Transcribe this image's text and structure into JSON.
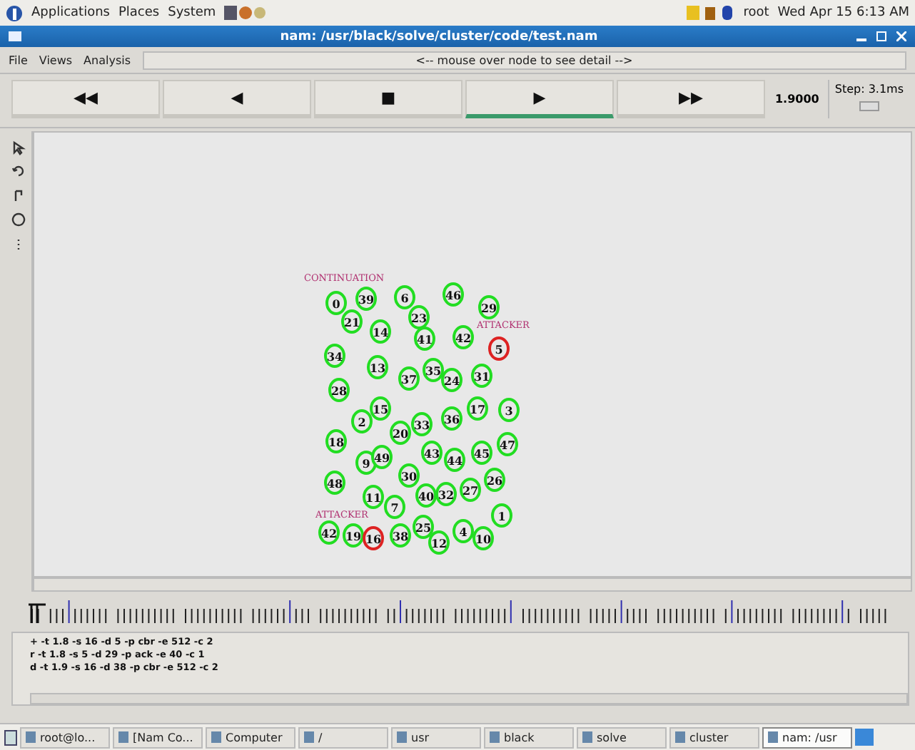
{
  "top_panel": {
    "menus": [
      "Applications",
      "Places",
      "System"
    ],
    "user": "root",
    "clock": "Wed Apr 15  6:13 AM"
  },
  "window": {
    "title": "nam: /usr/black/solve/cluster/code/test.nam"
  },
  "menubar": {
    "items": [
      "File",
      "Views",
      "Analysis"
    ],
    "status": "<-- mouse over node to see detail -->"
  },
  "controls": [
    {
      "label": "◀◀",
      "selected": false
    },
    {
      "label": "◀",
      "selected": false
    },
    {
      "label": "■",
      "selected": false
    },
    {
      "label": "▶",
      "selected": true
    },
    {
      "label": "▶▶",
      "selected": false
    }
  ],
  "time": "1.9000",
  "step": "Step: 3.1ms",
  "labels": [
    "CONTINUATION",
    "ATTACKER",
    "ATTACKER"
  ],
  "nodes": [
    {
      "label": "0",
      "color": "#22dd22"
    },
    {
      "label": "39",
      "color": "#22dd22"
    },
    {
      "label": "6",
      "color": "#22dd22"
    },
    {
      "label": "46",
      "color": "#22dd22"
    },
    {
      "label": "29",
      "color": "#22dd22"
    },
    {
      "label": "21",
      "color": "#22dd22"
    },
    {
      "label": "23",
      "color": "#22dd22"
    },
    {
      "label": "14",
      "color": "#22dd22"
    },
    {
      "label": "41",
      "color": "#22dd22"
    },
    {
      "label": "42",
      "color": "#22dd22"
    },
    {
      "label": "5",
      "color": "#dd2222"
    },
    {
      "label": "34",
      "color": "#22dd22"
    },
    {
      "label": "13",
      "color": "#22dd22"
    },
    {
      "label": "37",
      "color": "#22dd22"
    },
    {
      "label": "35",
      "color": "#22dd22"
    },
    {
      "label": "24",
      "color": "#22dd22"
    },
    {
      "label": "31",
      "color": "#22dd22"
    },
    {
      "label": "28",
      "color": "#22dd22"
    },
    {
      "label": "15",
      "color": "#22dd22"
    },
    {
      "label": "2",
      "color": "#22dd22"
    },
    {
      "label": "17",
      "color": "#22dd22"
    },
    {
      "label": "3",
      "color": "#22dd22"
    },
    {
      "label": "20",
      "color": "#22dd22"
    },
    {
      "label": "33",
      "color": "#22dd22"
    },
    {
      "label": "36",
      "color": "#22dd22"
    },
    {
      "label": "18",
      "color": "#22dd22"
    },
    {
      "label": "47",
      "color": "#22dd22"
    },
    {
      "label": "9",
      "color": "#22dd22"
    },
    {
      "label": "49",
      "color": "#22dd22"
    },
    {
      "label": "43",
      "color": "#22dd22"
    },
    {
      "label": "44",
      "color": "#22dd22"
    },
    {
      "label": "45",
      "color": "#22dd22"
    },
    {
      "label": "48",
      "color": "#22dd22"
    },
    {
      "label": "30",
      "color": "#22dd22"
    },
    {
      "label": "26",
      "color": "#22dd22"
    },
    {
      "label": "11",
      "color": "#22dd22"
    },
    {
      "label": "40",
      "color": "#22dd22"
    },
    {
      "label": "32",
      "color": "#22dd22"
    },
    {
      "label": "27",
      "color": "#22dd22"
    },
    {
      "label": "1",
      "color": "#22dd22"
    },
    {
      "label": "7",
      "color": "#22dd22"
    },
    {
      "label": "42",
      "color": "#22dd22"
    },
    {
      "label": "19",
      "color": "#22dd22"
    },
    {
      "label": "16",
      "color": "#dd2222"
    },
    {
      "label": "38",
      "color": "#22dd22"
    },
    {
      "label": "25",
      "color": "#22dd22"
    },
    {
      "label": "12",
      "color": "#22dd22"
    },
    {
      "label": "4",
      "color": "#22dd22"
    },
    {
      "label": "10",
      "color": "#22dd22"
    }
  ],
  "log": [
    "+ -t 1.8 -s 16 -d 5 -p cbr -e 512 -c 2",
    "r -t 1.8 -s 5 -d 29 -p ack -e 40 -c 1",
    "d -t 1.9 -s 16 -d 38 -p cbr -e 512 -c 2"
  ],
  "taskbar": [
    {
      "label": "root@lo...",
      "selected": false
    },
    {
      "label": "[Nam Co...",
      "selected": false
    },
    {
      "label": "Computer",
      "selected": false
    },
    {
      "label": "/",
      "selected": false
    },
    {
      "label": "usr",
      "selected": false
    },
    {
      "label": "black",
      "selected": false
    },
    {
      "label": "solve",
      "selected": false
    },
    {
      "label": "cluster",
      "selected": false
    },
    {
      "label": "nam: /usr",
      "selected": true
    }
  ]
}
